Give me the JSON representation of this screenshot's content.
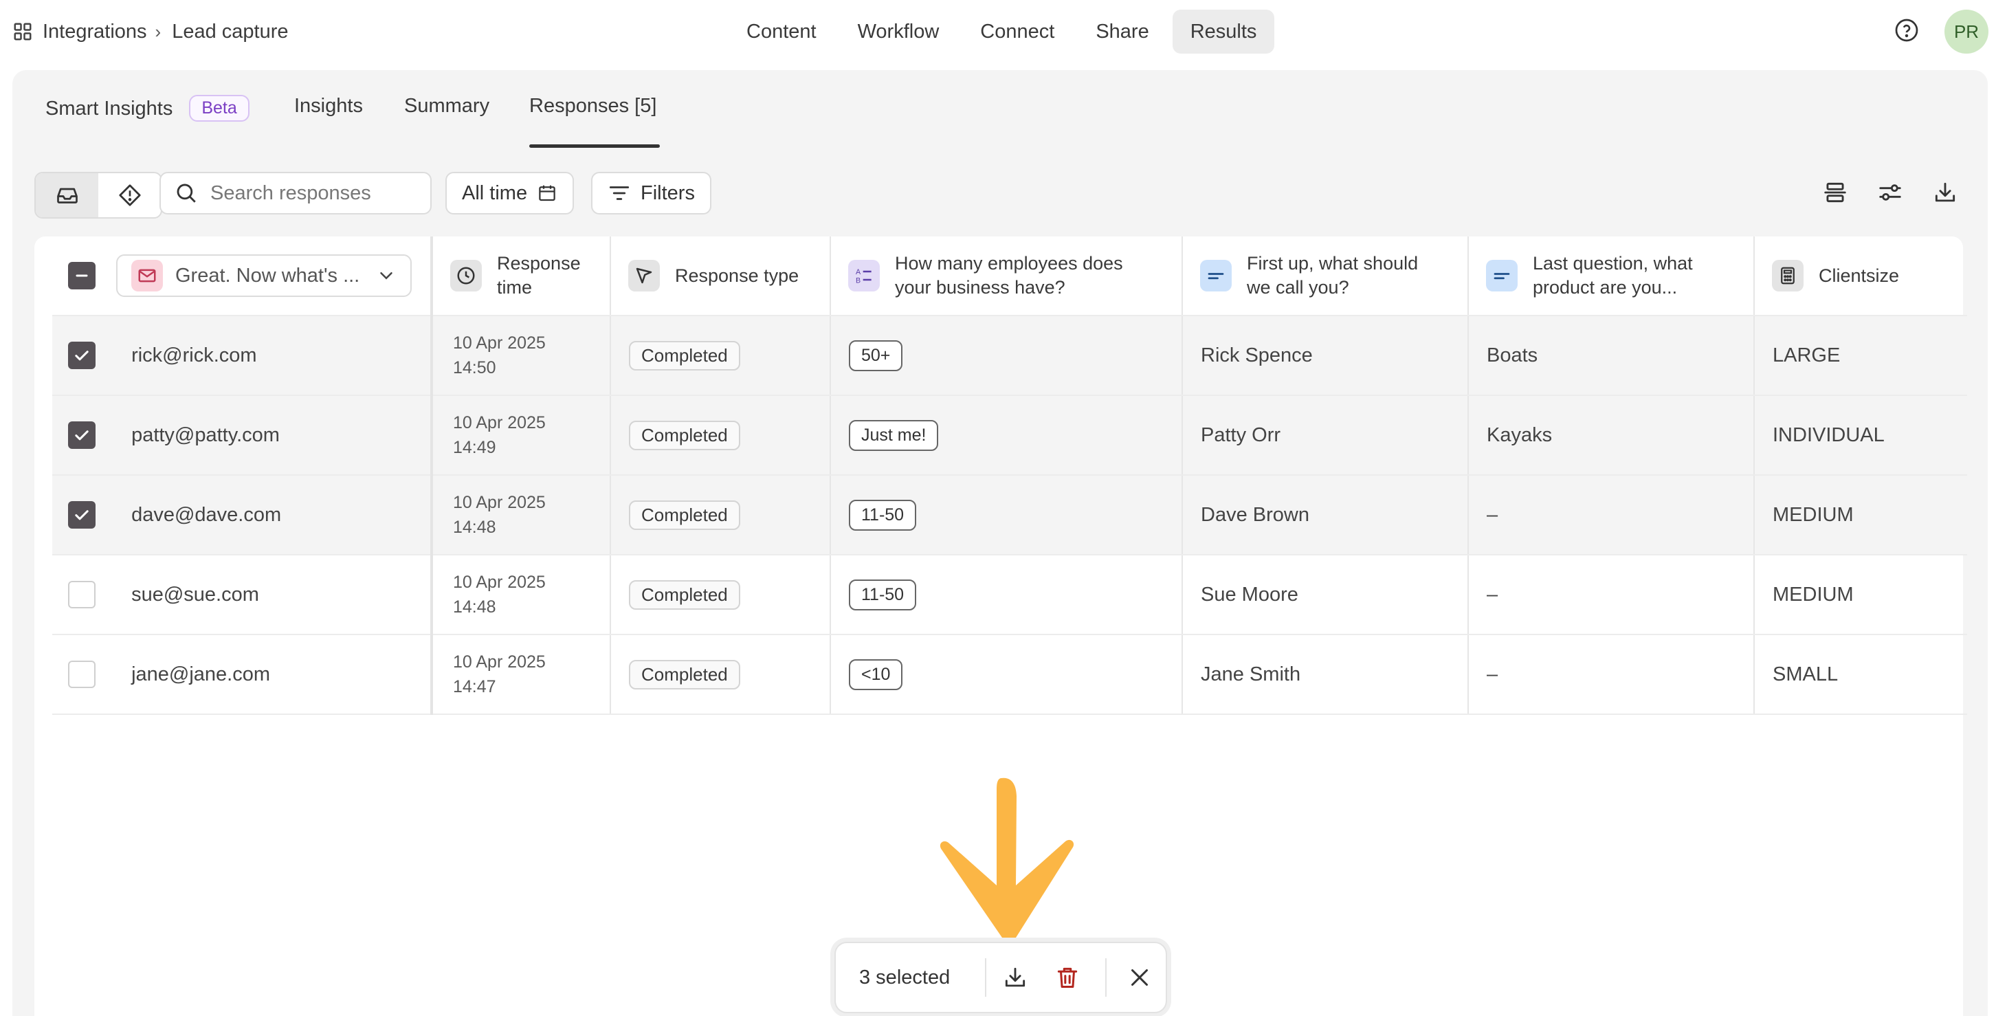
{
  "breadcrumb": {
    "root": "Integrations",
    "separator": "›",
    "current": "Lead capture"
  },
  "top_nav": [
    {
      "label": "Content",
      "active": false
    },
    {
      "label": "Workflow",
      "active": false
    },
    {
      "label": "Connect",
      "active": false
    },
    {
      "label": "Share",
      "active": false
    },
    {
      "label": "Results",
      "active": true
    }
  ],
  "user": {
    "initials": "PR"
  },
  "sub_tabs": {
    "smart_insights": "Smart Insights",
    "beta": "Beta",
    "insights": "Insights",
    "summary": "Summary",
    "responses": "Responses [5]"
  },
  "toolbar": {
    "search_placeholder": "Search responses",
    "date_filter": "All time",
    "filters": "Filters"
  },
  "table": {
    "question_select": "Great. Now what's ...",
    "headers": {
      "response_time": [
        "Response",
        "time"
      ],
      "response_type": "Response type",
      "employees": [
        "How many employees does",
        "your business have?"
      ],
      "name": [
        "First up, what should",
        "we call you?"
      ],
      "product": [
        "Last question, what",
        "product are you..."
      ],
      "clientsize": "Clientsize"
    },
    "rows": [
      {
        "selected": true,
        "email": "rick@rick.com",
        "date": "10 Apr 2025",
        "time": "14:50",
        "type": "Completed",
        "employees": "50+",
        "name": "Rick Spence",
        "product": "Boats",
        "clientsize": "LARGE"
      },
      {
        "selected": true,
        "email": "patty@patty.com",
        "date": "10 Apr 2025",
        "time": "14:49",
        "type": "Completed",
        "employees": "Just me!",
        "name": "Patty Orr",
        "product": "Kayaks",
        "clientsize": "INDIVIDUAL"
      },
      {
        "selected": true,
        "email": "dave@dave.com",
        "date": "10 Apr 2025",
        "time": "14:48",
        "type": "Completed",
        "employees": "11-50",
        "name": "Dave Brown",
        "product": "–",
        "clientsize": "MEDIUM"
      },
      {
        "selected": false,
        "email": "sue@sue.com",
        "date": "10 Apr 2025",
        "time": "14:48",
        "type": "Completed",
        "employees": "11-50",
        "name": "Sue Moore",
        "product": "–",
        "clientsize": "MEDIUM"
      },
      {
        "selected": false,
        "email": "jane@jane.com",
        "date": "10 Apr 2025",
        "time": "14:47",
        "type": "Completed",
        "employees": "<10",
        "name": "Jane Smith",
        "product": "–",
        "clientsize": "SMALL"
      }
    ]
  },
  "selection_bar": {
    "count_label": "3 selected"
  },
  "colors": {
    "accent_arrow": "#FBB645",
    "checkbox_checked": "#555055",
    "question_icon_pink": "#fad4dc",
    "question_icon_purple": "#e3dcf7",
    "question_icon_blue": "#cde2fb"
  },
  "icons": [
    "grid-icon",
    "help-icon",
    "inbox-icon",
    "partial-response-icon",
    "search-icon",
    "calendar-icon",
    "filter-icon",
    "collapse-rows-icon",
    "settings-sliders-icon",
    "download-icon",
    "mail-icon",
    "chevron-down-icon",
    "clock-icon",
    "funnel-icon",
    "multiple-choice-icon",
    "short-text-icon",
    "calculator-icon",
    "trash-icon",
    "close-icon",
    "arrow-down-annotation"
  ]
}
